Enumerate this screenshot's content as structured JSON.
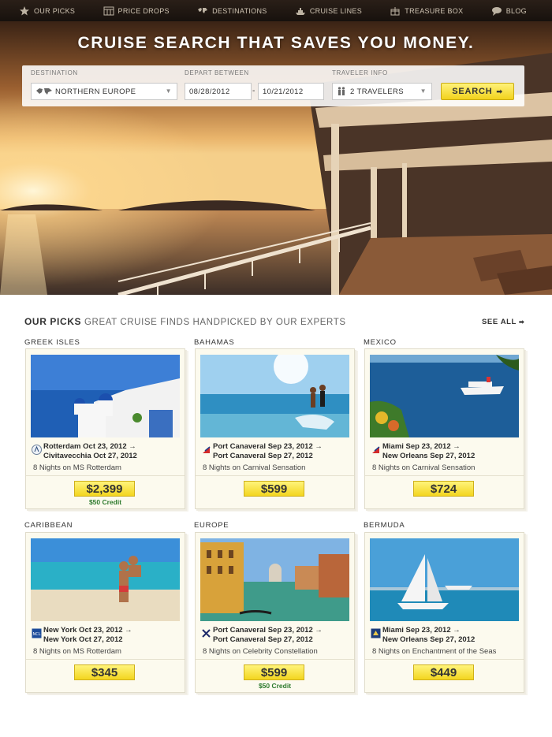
{
  "nav": {
    "items": [
      {
        "label": "OUR PICKS",
        "icon": "star-icon"
      },
      {
        "label": "PRICE DROPS",
        "icon": "calendar-icon"
      },
      {
        "label": "DESTINATIONS",
        "icon": "world-map-icon"
      },
      {
        "label": "CRUISE LINES",
        "icon": "ship-icon"
      },
      {
        "label": "TREASURE BOX",
        "icon": "gift-icon"
      },
      {
        "label": "BLOG",
        "icon": "speech-bubble-icon"
      }
    ]
  },
  "hero": {
    "title": "CRUISE SEARCH THAT SAVES YOU MONEY."
  },
  "search": {
    "destination_label": "DESTINATION",
    "destination_value": "NORTHERN EUROPE",
    "depart_label": "DEPART BETWEEN",
    "depart_from": "08/28/2012",
    "depart_to": "10/21/2012",
    "date_separator": "-",
    "traveler_label": "TRAVELER INFO",
    "traveler_value": "2 TRAVELERS",
    "button_label": "SEARCH"
  },
  "picks": {
    "title": "OUR PICKS",
    "subtitle": "GREAT CRUISE FINDS HANDPICKED BY OUR EXPERTS",
    "see_all": "SEE ALL",
    "cards": [
      {
        "region": "GREEK ISLES",
        "from": "Rotterdam Oct 23, 2012",
        "to": "Civitavecchia Oct 27, 2012",
        "ship": "8 Nights on MS Rotterdam",
        "price": "$2,399",
        "credit": "$50 Credit",
        "line_logo": "holland-america-logo-icon"
      },
      {
        "region": "BAHAMAS",
        "from": "Port Canaveral Sep 23, 2012",
        "to": "Port Canaveral Sep 27, 2012",
        "ship": "8 Nights on Carnival Sensation",
        "price": "$599",
        "credit": "",
        "line_logo": "carnival-logo-icon"
      },
      {
        "region": "MEXICO",
        "from": "Miami Sep 23, 2012",
        "to": "New Orleans Sep 27, 2012",
        "ship": "8 Nights on Carnival Sensation",
        "price": "$724",
        "credit": "",
        "line_logo": "carnival-logo-icon"
      },
      {
        "region": "CARIBBEAN",
        "from": "New York Oct 23, 2012",
        "to": "New York Oct 27, 2012",
        "ship": "8 Nights on MS Rotterdam",
        "price": "$345",
        "credit": "",
        "line_logo": "ncl-logo-icon"
      },
      {
        "region": "EUROPE",
        "from": "Port Canaveral Sep 23, 2012",
        "to": "Port Canaveral Sep 27, 2012",
        "ship": "8 Nights on Celebrity Constellation",
        "price": "$599",
        "credit": "$50 Credit",
        "line_logo": "celebrity-logo-icon"
      },
      {
        "region": "BERMUDA",
        "from": "Miami Sep 23, 2012",
        "to": "New Orleans Sep 27, 2012",
        "ship": "8 Nights on Enchantment of the Seas",
        "price": "$449",
        "credit": "",
        "line_logo": "royal-caribbean-logo-icon"
      }
    ]
  },
  "colors": {
    "nav_bg": "#1e1611",
    "accent_yellow": "#f3d51f",
    "credit_green": "#2d7a2d",
    "card_bg": "#fcfaee"
  }
}
